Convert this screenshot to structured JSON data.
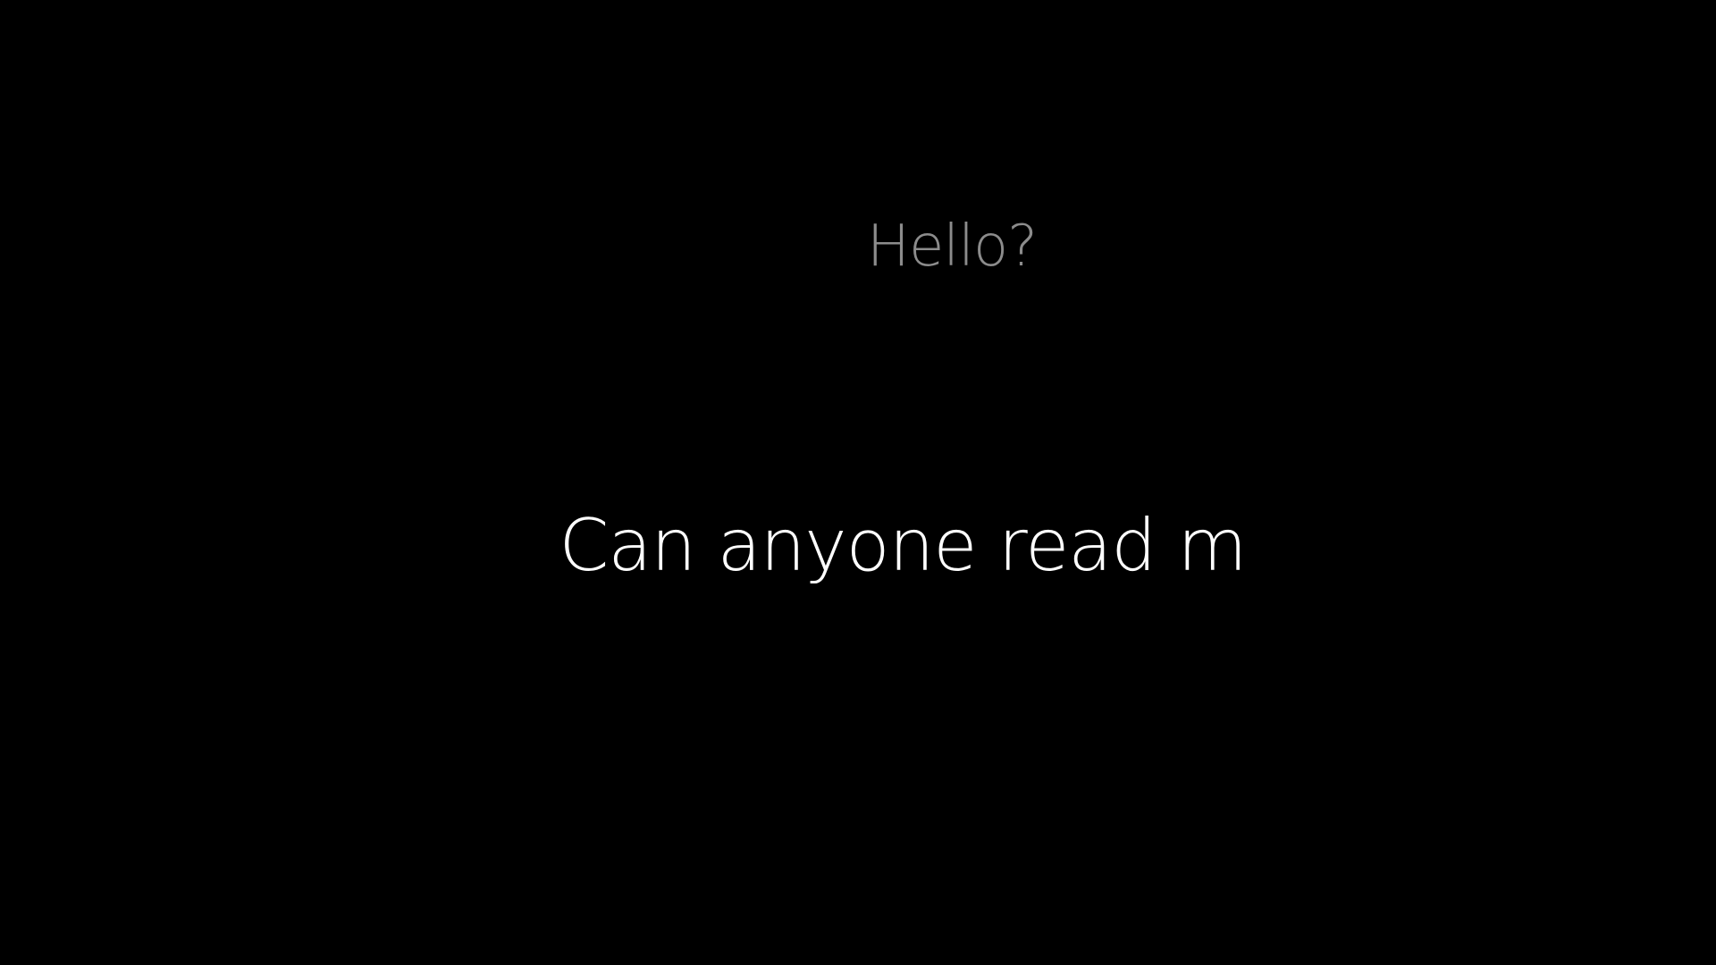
{
  "screen": {
    "background_color": "#000000",
    "lines": {
      "first": {
        "text": "Hello?",
        "color": "#8c8c8c"
      },
      "second": {
        "text": "Can anyone read m",
        "color": "#ffffff"
      }
    }
  }
}
